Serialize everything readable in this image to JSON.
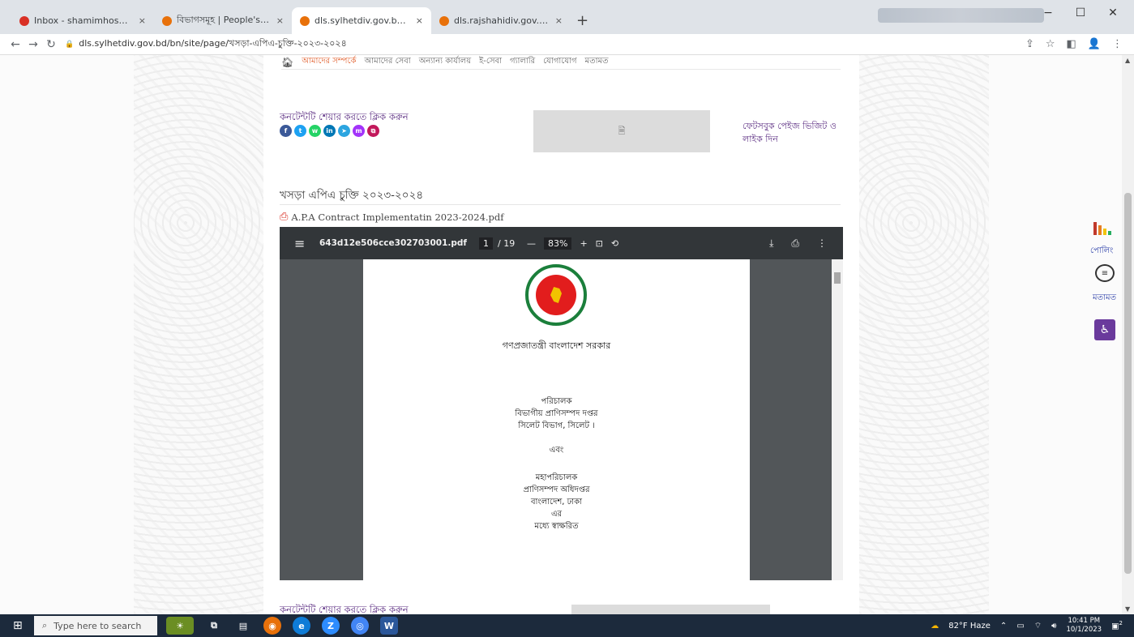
{
  "browser": {
    "tabs": [
      {
        "title": "Inbox - shamimhossainims@gm",
        "favicon_color": "#d93025"
      },
      {
        "title": "বিভাগসমূহ | People's Republic o",
        "favicon_color": "#e8710a"
      },
      {
        "title": "dls.sylhetdiv.gov.bd/bn/site/pa",
        "favicon_color": "#e8710a"
      },
      {
        "title": "dls.rajshahidiv.gov.bd/bn/site/",
        "favicon_color": "#e8710a"
      }
    ],
    "new_tab": "+",
    "close_glyph": "×",
    "url": "dls.sylhetdiv.gov.bd/bn/site/page/খসড়া-এপিএ-চুক্তি-২০২৩-২০২৪"
  },
  "page": {
    "topnav": [
      "আমাদের সম্পর্কে",
      "আমাদের সেবা",
      "অন্যান্য কার্যালয়",
      "ই-সেবা",
      "গ্যালারি",
      "যোগাযোগ",
      "মতামত"
    ],
    "share_label": "কনটেন্টটি শেয়ার করতে ক্লিক করুন",
    "share_icons": [
      {
        "name": "facebook",
        "glyph": "f",
        "color": "#3b5998"
      },
      {
        "name": "twitter",
        "glyph": "t",
        "color": "#1da1f2"
      },
      {
        "name": "whatsapp",
        "glyph": "w",
        "color": "#25d366"
      },
      {
        "name": "linkedin",
        "glyph": "in",
        "color": "#0077b5"
      },
      {
        "name": "telegram",
        "glyph": "➤",
        "color": "#2ca5e0"
      },
      {
        "name": "messenger",
        "glyph": "m",
        "color": "#a334fa"
      },
      {
        "name": "copy",
        "glyph": "⧉",
        "color": "#c2185b"
      }
    ],
    "fb_placeholder_icon": "🗎",
    "fb_link": "ফেটসবুক পেইজ ভিজিট ও লাইক দিন",
    "title": "খসড়া এপিএ চুক্তি ২০২৩-২০২৪",
    "pdf_link": "A.P.A Contract Implementatin 2023-2024.pdf"
  },
  "pdf": {
    "filename": "643d12e506cce302703001.pdf",
    "current_page": "1",
    "total_pages": "/ 19",
    "zoom": "83%",
    "doc_lines": [
      "গণপ্রজাতন্ত্রী বাংলাদেশ সরকার",
      "পরিচালক",
      "বিভাগীয় প্রাণিসম্পদ দপ্তর",
      "সিলেট বিভাগ, সিলেট ।",
      "এবং",
      "মহাপরিচালক",
      "প্রাণিসম্পদ অধিদপ্তর",
      "বাংলাদেশ, ঢাকা",
      "এর",
      "মধ্যে স্বাক্ষরিত"
    ]
  },
  "widgets": {
    "poll_label": "পোলিং",
    "feedback_label": "মতামত",
    "accessibility_icon": "accessibility-icon"
  },
  "taskbar": {
    "search_placeholder": "Type here to search",
    "weather": "82°F  Haze",
    "time": "10:41 PM",
    "date": "10/1/2023",
    "notification_count": "2"
  }
}
